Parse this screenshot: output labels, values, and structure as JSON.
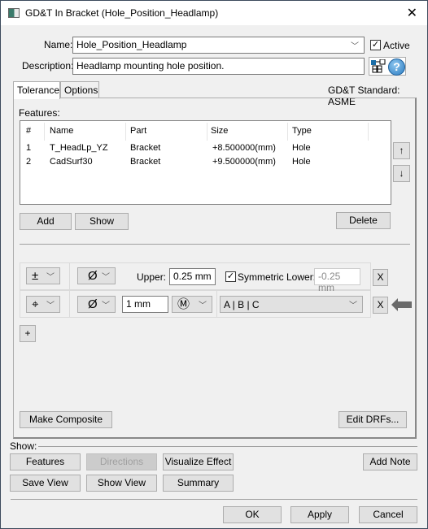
{
  "window": {
    "title": "GD&T In Bracket (Hole_Position_Headlamp)",
    "close_icon": "close-icon"
  },
  "name": {
    "label": "Name:",
    "value": "Hole_Position_Headlamp",
    "active_label": "Active",
    "active_checked": true
  },
  "description": {
    "label": "Description:",
    "value": "Headlamp mounting hole position."
  },
  "tabs": [
    {
      "label": "Tolerance",
      "selected": true
    },
    {
      "label": "Options",
      "selected": false
    }
  ],
  "standard": "GD&T Standard: ASME",
  "features": {
    "label": "Features:",
    "columns": [
      "#",
      "Name",
      "Part",
      "Size",
      "Type"
    ],
    "rows": [
      [
        "1",
        "T_HeadLp_YZ",
        "Bracket",
        "+8.500000(mm)",
        "Hole"
      ],
      [
        "2",
        "CadSurf30",
        "Bracket",
        "+9.500000(mm)",
        "Hole"
      ]
    ],
    "up_label": "↑",
    "down_label": "↓",
    "add_label": "Add",
    "show_label": "Show",
    "delete_label": "Delete"
  },
  "tolerance_rows": [
    {
      "symbol": "±",
      "modifier": "Ø",
      "upper_label": "Upper:",
      "upper_value": "0.25 mm",
      "symmetric_label": "Symmetric Lower:",
      "symmetric_checked": true,
      "lower_value": "-0.25 mm",
      "remove_label": "X"
    },
    {
      "symbol": "⌖",
      "modifier": "Ø",
      "value": "1 mm",
      "material": "Ⓜ",
      "datums": "A | B | C",
      "remove_label": "X"
    }
  ],
  "add_row_label": "+",
  "make_composite_label": "Make Composite",
  "edit_drfs_label": "Edit DRFs...",
  "show": {
    "label": "Show:",
    "buttons": [
      "Features",
      "Directions",
      "Visualize Effect",
      "Add Note",
      "Save View",
      "Show View",
      "Summary"
    ]
  },
  "footer": {
    "ok": "OK",
    "apply": "Apply",
    "cancel": "Cancel"
  }
}
